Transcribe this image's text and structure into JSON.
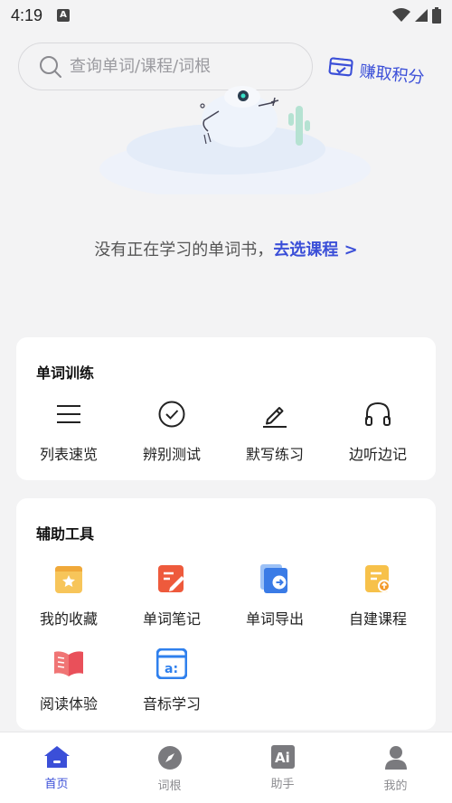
{
  "status_bar": {
    "time": "4:19",
    "app_indicator": "A"
  },
  "search": {
    "placeholder": "查询单词/课程/词根"
  },
  "earn_points": {
    "label": "赚取积分",
    "icon": "credit-card-check-icon"
  },
  "empty_state": {
    "message": "没有正在学习的单词书，",
    "link_label": "去选课程 >"
  },
  "word_training": {
    "title": "单词训练",
    "items": [
      {
        "label": "列表速览",
        "icon": "list-icon"
      },
      {
        "label": "辨别测试",
        "icon": "check-circle-icon"
      },
      {
        "label": "默写练习",
        "icon": "pencil-icon"
      },
      {
        "label": "边听边记",
        "icon": "headphones-icon"
      }
    ]
  },
  "tools": {
    "title": "辅助工具",
    "items": [
      {
        "label": "我的收藏",
        "icon": "star-bookmark-icon"
      },
      {
        "label": "单词笔记",
        "icon": "note-edit-icon"
      },
      {
        "label": "单词导出",
        "icon": "export-icon"
      },
      {
        "label": "自建课程",
        "icon": "custom-course-icon"
      },
      {
        "label": "阅读体验",
        "icon": "open-book-icon"
      },
      {
        "label": "音标学习",
        "icon": "phonetic-icon"
      }
    ]
  },
  "tabbar": {
    "items": [
      {
        "label": "首页",
        "icon": "home-icon",
        "active": true
      },
      {
        "label": "词根",
        "icon": "compass-icon",
        "active": false
      },
      {
        "label": "助手",
        "icon": "ai-icon",
        "active": false
      },
      {
        "label": "我的",
        "icon": "user-icon",
        "active": false
      }
    ]
  },
  "colors": {
    "accent": "#3b4fd8",
    "background": "#f3f3f4",
    "card": "#ffffff"
  }
}
